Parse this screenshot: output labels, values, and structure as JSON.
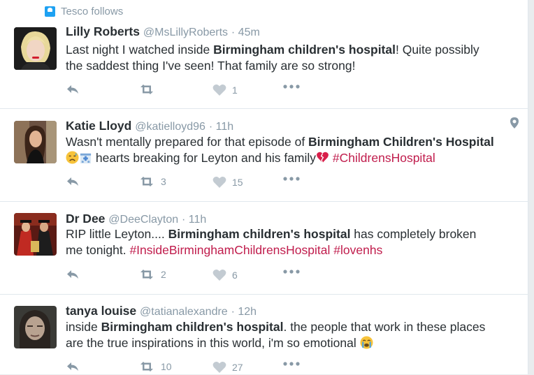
{
  "context": {
    "label": "Tesco follows"
  },
  "tweets": [
    {
      "name": "Lilly Roberts",
      "handle": "@MsLillyRoberts",
      "time": "· 45m",
      "segments": [
        {
          "t": "Last night I watched inside "
        },
        {
          "t": "Birmingham children's hospital",
          "b": true
        },
        {
          "t": "! Quite possibly"
        },
        {
          "br": true
        },
        {
          "t": "the saddest thing I've seen! That family are so strong!"
        }
      ],
      "retweets": "",
      "likes": "1"
    },
    {
      "name": "Katie Lloyd",
      "handle": "@katielloyd96",
      "time": "· 11h",
      "segments": [
        {
          "t": "Wasn't mentally prepared for that episode of "
        },
        {
          "t": "Birmingham Children's Hospital",
          "b": true
        },
        {
          "br": true
        },
        {
          "emoji": "disappointed-relieved-emoji"
        },
        {
          "emoji": "hospital-emoji"
        },
        {
          "t": " hearts breaking for Leyton and his family"
        },
        {
          "emoji": "broken-heart-emoji"
        },
        {
          "t": "  "
        },
        {
          "t": "#ChildrensHospital",
          "h": true
        }
      ],
      "retweets": "3",
      "likes": "15"
    },
    {
      "name": "Dr Dee",
      "handle": "@DeeClayton",
      "time": "· 11h",
      "segments": [
        {
          "t": "RIP little Leyton.... "
        },
        {
          "t": "Birmingham children's hospital",
          "b": true
        },
        {
          "t": " has completely broken"
        },
        {
          "br": true
        },
        {
          "t": "me tonight. "
        },
        {
          "t": "#InsideBirminghamChildrensHospital",
          "h": true
        },
        {
          "t": " "
        },
        {
          "t": "#lovenhs",
          "h": true
        }
      ],
      "retweets": "2",
      "likes": "6"
    },
    {
      "name": "tanya louise",
      "handle": "@tatianalexandre",
      "time": "· 12h",
      "segments": [
        {
          "t": "inside "
        },
        {
          "t": "Birmingham children's hospital",
          "b": true
        },
        {
          "t": ". the people that work in these places"
        },
        {
          "br": true
        },
        {
          "t": "are the true inspirations in this world, i'm so emotional "
        },
        {
          "emoji": "crying-face-emoji"
        }
      ],
      "retweets": "10",
      "likes": "27"
    }
  ],
  "colors": {
    "hashtag": "#c01c4c",
    "meta": "#8899a6",
    "like": "#c3cbd2",
    "text": "#292f33"
  }
}
